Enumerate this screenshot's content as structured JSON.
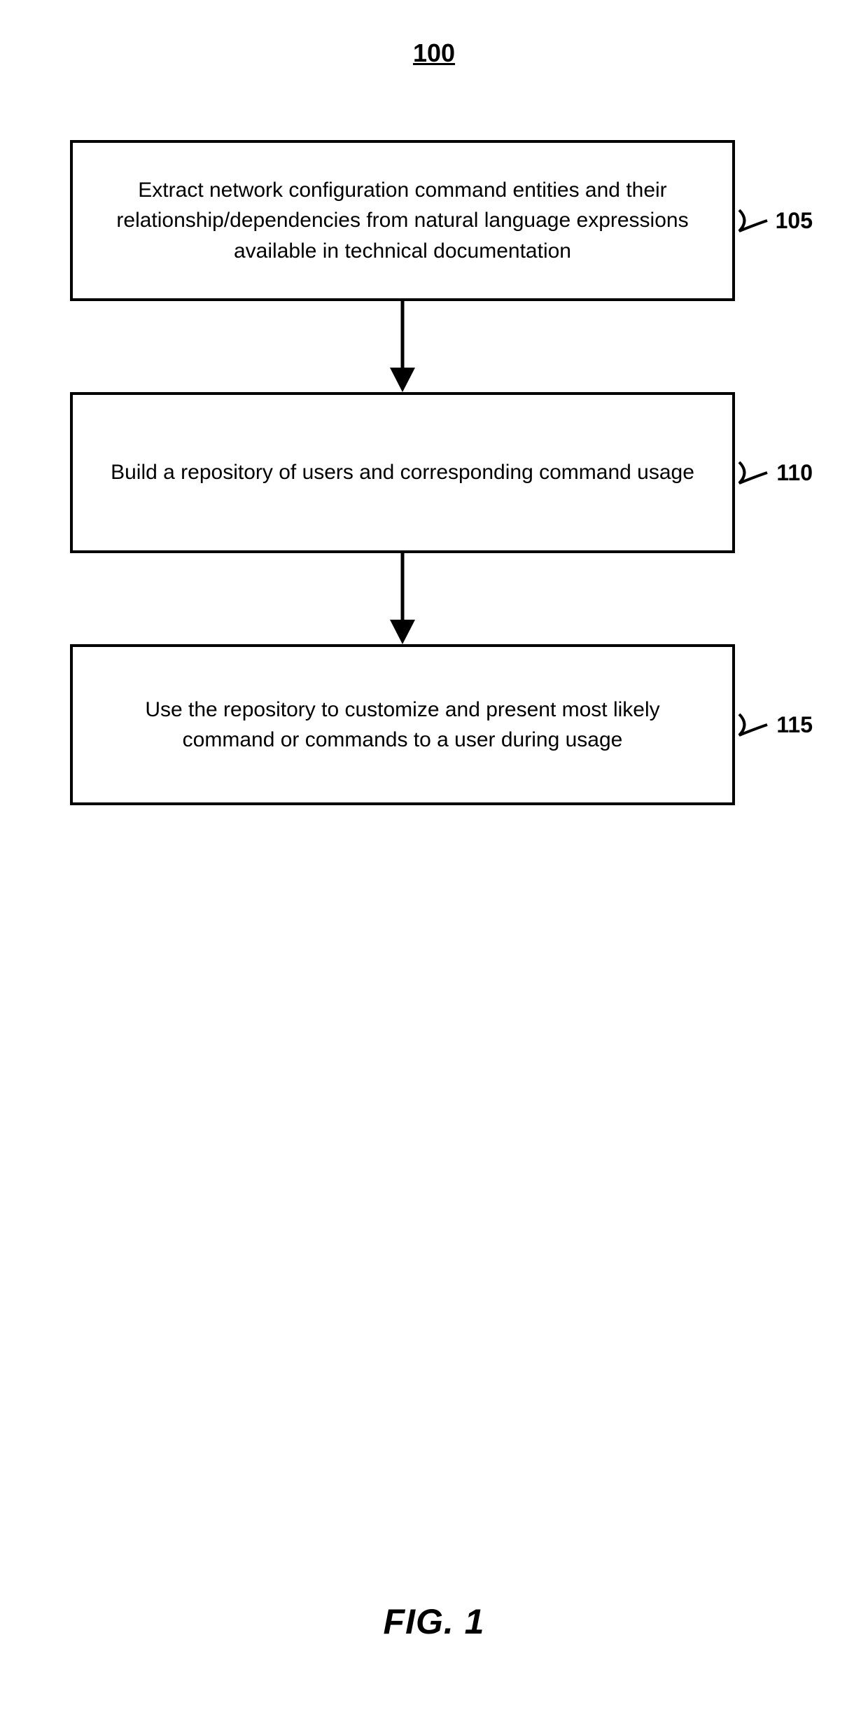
{
  "figure_number": "100",
  "figure_caption": "FIG. 1",
  "steps": [
    {
      "text": "Extract network configuration command entities and their relationship/dependencies from natural language expressions available in technical documentation",
      "label": "105"
    },
    {
      "text": "Build a repository of users and corresponding command usage",
      "label": "110"
    },
    {
      "text": "Use the repository to customize and present most likely command or commands to a user during usage",
      "label": "115"
    }
  ]
}
